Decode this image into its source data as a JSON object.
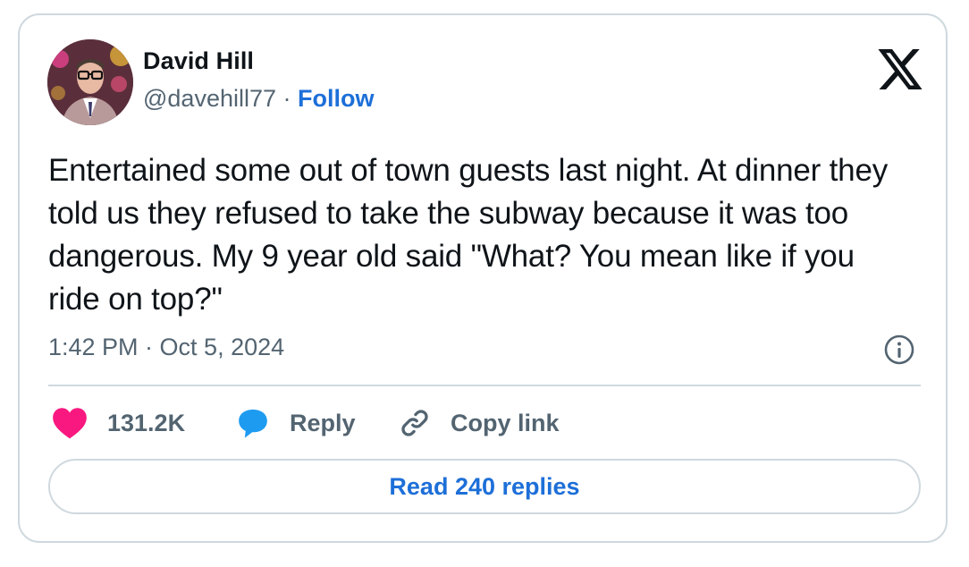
{
  "author": {
    "name": "David Hill",
    "handle": "@davehill77",
    "separator": "·",
    "follow_label": "Follow"
  },
  "tweet": {
    "text": "Entertained some out of town guests last night. At dinner they told us they refused to take the subway because it was too dangerous. My 9 year old said \"What? You mean like if you ride on top?\"",
    "timestamp": "1:42 PM · Oct 5, 2024"
  },
  "actions": {
    "likes": "131.2K",
    "reply_label": "Reply",
    "copy_link_label": "Copy link"
  },
  "read_replies_label": "Read 240 replies",
  "icons": {
    "brand": "x-logo-icon",
    "info": "info-icon",
    "like": "heart-icon",
    "reply": "speech-bubble-icon",
    "copy": "link-icon"
  },
  "colors": {
    "link_blue": "#1d6fd8",
    "heart_pink": "#f91880",
    "reply_blue": "#1d9bf0",
    "muted_text": "#536471",
    "border": "#cfd9de"
  }
}
